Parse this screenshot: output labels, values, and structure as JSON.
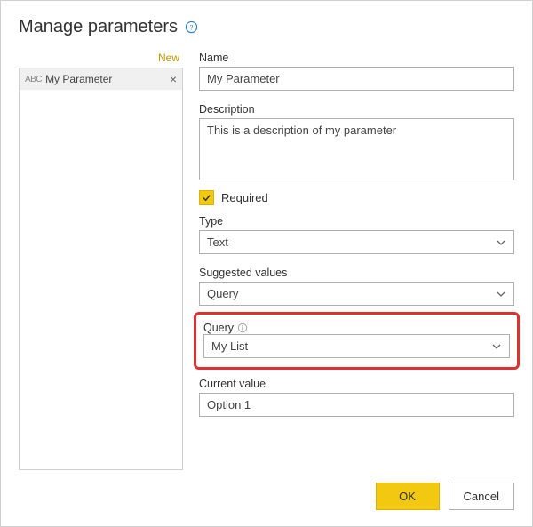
{
  "dialog": {
    "title": "Manage parameters",
    "newLabel": "New"
  },
  "sidebar": {
    "items": [
      {
        "typeGlyph": "ABC",
        "label": "My Parameter"
      }
    ]
  },
  "form": {
    "name": {
      "label": "Name",
      "value": "My Parameter"
    },
    "description": {
      "label": "Description",
      "value": "This is a description of my parameter"
    },
    "required": {
      "label": "Required",
      "checked": true
    },
    "type": {
      "label": "Type",
      "value": "Text"
    },
    "suggestedValues": {
      "label": "Suggested values",
      "value": "Query"
    },
    "query": {
      "label": "Query",
      "value": "My List"
    },
    "currentValue": {
      "label": "Current value",
      "value": "Option 1"
    }
  },
  "buttons": {
    "ok": "OK",
    "cancel": "Cancel"
  }
}
